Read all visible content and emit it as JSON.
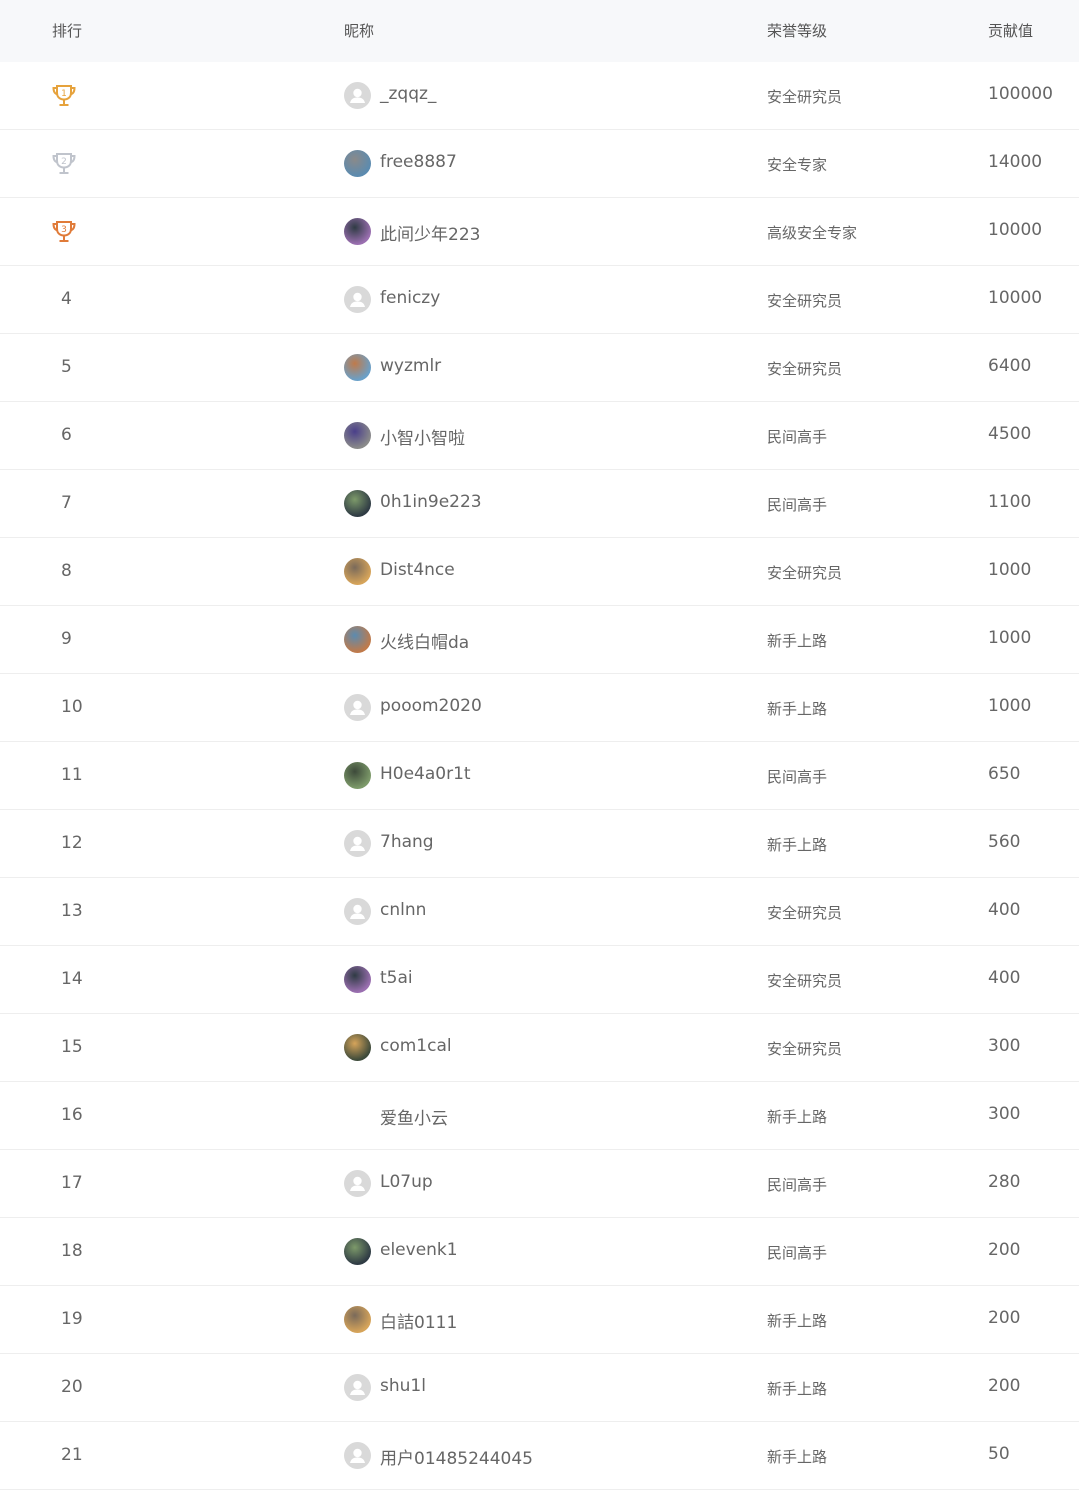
{
  "header": {
    "rank": "排行",
    "nickname": "昵称",
    "level": "荣誉等级",
    "score": "贡献值"
  },
  "colors": {
    "gold": "#e6a23c",
    "silver": "#c0c4cc",
    "bronze": "#e07b39",
    "default_avatar": "#d9d9d9"
  },
  "rows": [
    {
      "rank": "1",
      "trophy": "gold-trophy-icon",
      "avatar": "default-avatar-icon",
      "nickname": "_zqqz_",
      "level": "安全研究员",
      "score": "100000"
    },
    {
      "rank": "2",
      "trophy": "silver-trophy-icon",
      "avatar": "user-avatar-photo",
      "nickname": "free8887",
      "level": "安全专家",
      "score": "14000"
    },
    {
      "rank": "3",
      "trophy": "bronze-trophy-icon",
      "avatar": "user-avatar-photo",
      "nickname": "此间少年223",
      "level": "高级安全专家",
      "score": "10000"
    },
    {
      "rank": "4",
      "avatar": "default-avatar-icon",
      "nickname": "feniczy",
      "level": "安全研究员",
      "score": "10000"
    },
    {
      "rank": "5",
      "avatar": "user-avatar-photo",
      "nickname": "wyzmlr",
      "level": "安全研究员",
      "score": "6400"
    },
    {
      "rank": "6",
      "avatar": "user-avatar-photo",
      "nickname": "小智小智啦",
      "level": "民间高手",
      "score": "4500"
    },
    {
      "rank": "7",
      "avatar": "user-avatar-photo",
      "nickname": "0h1in9e223",
      "level": "民间高手",
      "score": "1100"
    },
    {
      "rank": "8",
      "avatar": "user-avatar-photo",
      "nickname": "Dist4nce",
      "level": "安全研究员",
      "score": "1000"
    },
    {
      "rank": "9",
      "avatar": "user-avatar-photo",
      "nickname": "火线白帽da",
      "level": "新手上路",
      "score": "1000"
    },
    {
      "rank": "10",
      "avatar": "default-avatar-icon",
      "nickname": "pooom2020",
      "level": "新手上路",
      "score": "1000"
    },
    {
      "rank": "11",
      "avatar": "user-avatar-photo",
      "nickname": "H0e4a0r1t",
      "level": "民间高手",
      "score": "650"
    },
    {
      "rank": "12",
      "avatar": "default-avatar-icon",
      "nickname": "7hang",
      "level": "新手上路",
      "score": "560"
    },
    {
      "rank": "13",
      "avatar": "default-avatar-icon",
      "nickname": "cnlnn",
      "level": "安全研究员",
      "score": "400"
    },
    {
      "rank": "14",
      "avatar": "user-avatar-photo",
      "nickname": "t5ai",
      "level": "安全研究员",
      "score": "400"
    },
    {
      "rank": "15",
      "avatar": "user-avatar-photo",
      "nickname": "com1cal",
      "level": "安全研究员",
      "score": "300"
    },
    {
      "rank": "16",
      "avatar": "none",
      "nickname": "爱鱼小云",
      "level": "新手上路",
      "score": "300"
    },
    {
      "rank": "17",
      "avatar": "default-avatar-icon",
      "nickname": "L07up",
      "level": "民间高手",
      "score": "280"
    },
    {
      "rank": "18",
      "avatar": "user-avatar-photo",
      "nickname": "elevenk1",
      "level": "民间高手",
      "score": "200"
    },
    {
      "rank": "19",
      "avatar": "user-avatar-photo",
      "nickname": "白詰0111",
      "level": "新手上路",
      "score": "200"
    },
    {
      "rank": "20",
      "avatar": "default-avatar-icon",
      "nickname": "shu1l",
      "level": "新手上路",
      "score": "200"
    },
    {
      "rank": "21",
      "avatar": "default-avatar-icon",
      "nickname": "用户01485244045",
      "level": "新手上路",
      "score": "50"
    }
  ]
}
